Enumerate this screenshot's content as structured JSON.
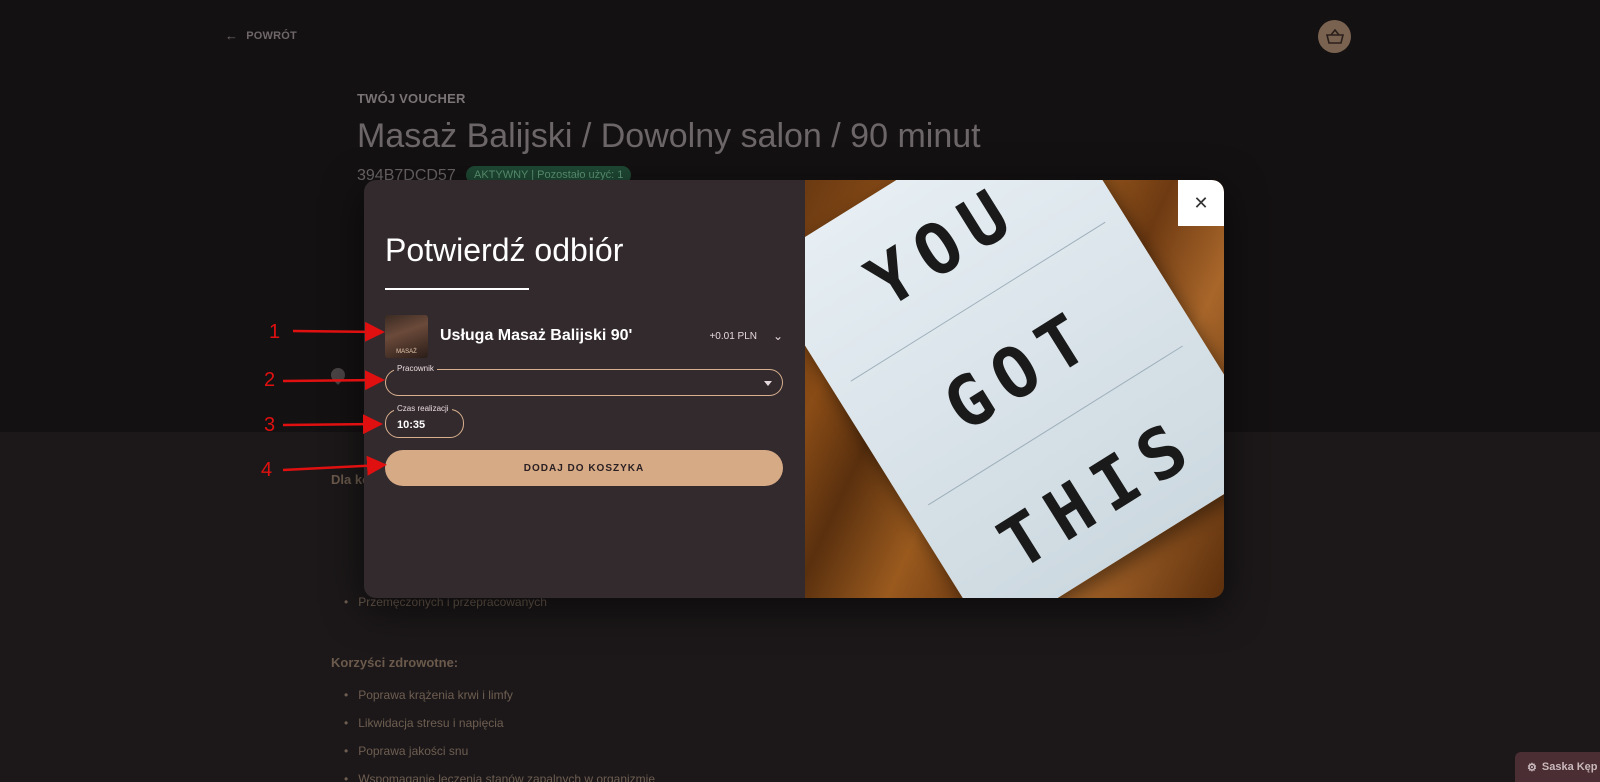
{
  "page": {
    "back_label": "POWRÓT",
    "eyebrow": "TWÓJ VOUCHER",
    "title": "Masaż Balijski / Dowolny salon / 90 minut",
    "voucher_code": "394B7DCD57",
    "status_badge": "AKTYWNY | Pozostało użyć: 1",
    "section_for": "Dla ko",
    "bullets_for_last": "Przemęczonych i przepracowanych",
    "section_health": "Korzyści zdrowotne:",
    "health_bullets": [
      "Poprawa krążenia krwi i limfy",
      "Likwidacja stresu i napięcia",
      "Poprawa jakości snu",
      "Wspomaganie leczenia stanów zapalnych w organizmie"
    ],
    "salon_button": "Saska Kęp"
  },
  "modal": {
    "title": "Potwierdź odbiór",
    "service": {
      "thumb_text": "MASAŻ",
      "name": "Usługa Masaż Balijski 90'",
      "price": "+0.01 PLN"
    },
    "employee_field": {
      "label": "Pracownik",
      "value": ""
    },
    "time_field": {
      "label": "Czas realizacji",
      "value": "10:35"
    },
    "add_button": "DODAJ DO KOSZYKA",
    "photo_text": [
      "YOU",
      "GOT",
      "THIS"
    ],
    "close_icon": "close-icon"
  },
  "annotations": [
    "1",
    "2",
    "3",
    "4"
  ],
  "colors": {
    "accent": "#d6aa85",
    "modal_bg": "#332a2e",
    "annotation": "#e01010"
  }
}
